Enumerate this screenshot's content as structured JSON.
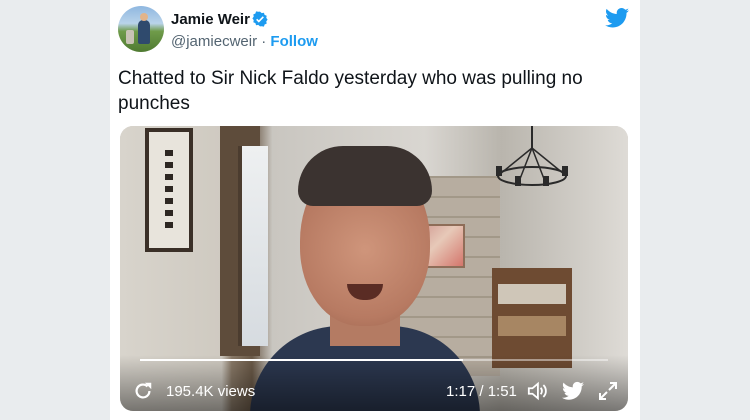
{
  "colors": {
    "brand": "#1d9bf0",
    "text": "#0f1419",
    "muted": "#536471",
    "background": "#e9ecee"
  },
  "tweet": {
    "author_name": "Jamie Weir",
    "handle": "@jamiecweir",
    "separator": " · ",
    "follow_label": "Follow",
    "text": "Chatted to Sir Nick Faldo yesterday who was pulling no punches"
  },
  "video": {
    "views": "195.4K views",
    "time": "1:17 / 1:51",
    "progress_fraction": 0.69
  },
  "icons": [
    "avatar",
    "verified-badge-icon",
    "twitter-bird-icon",
    "replay-icon",
    "volume-icon",
    "twitter-bird-video-icon",
    "expand-icon"
  ]
}
